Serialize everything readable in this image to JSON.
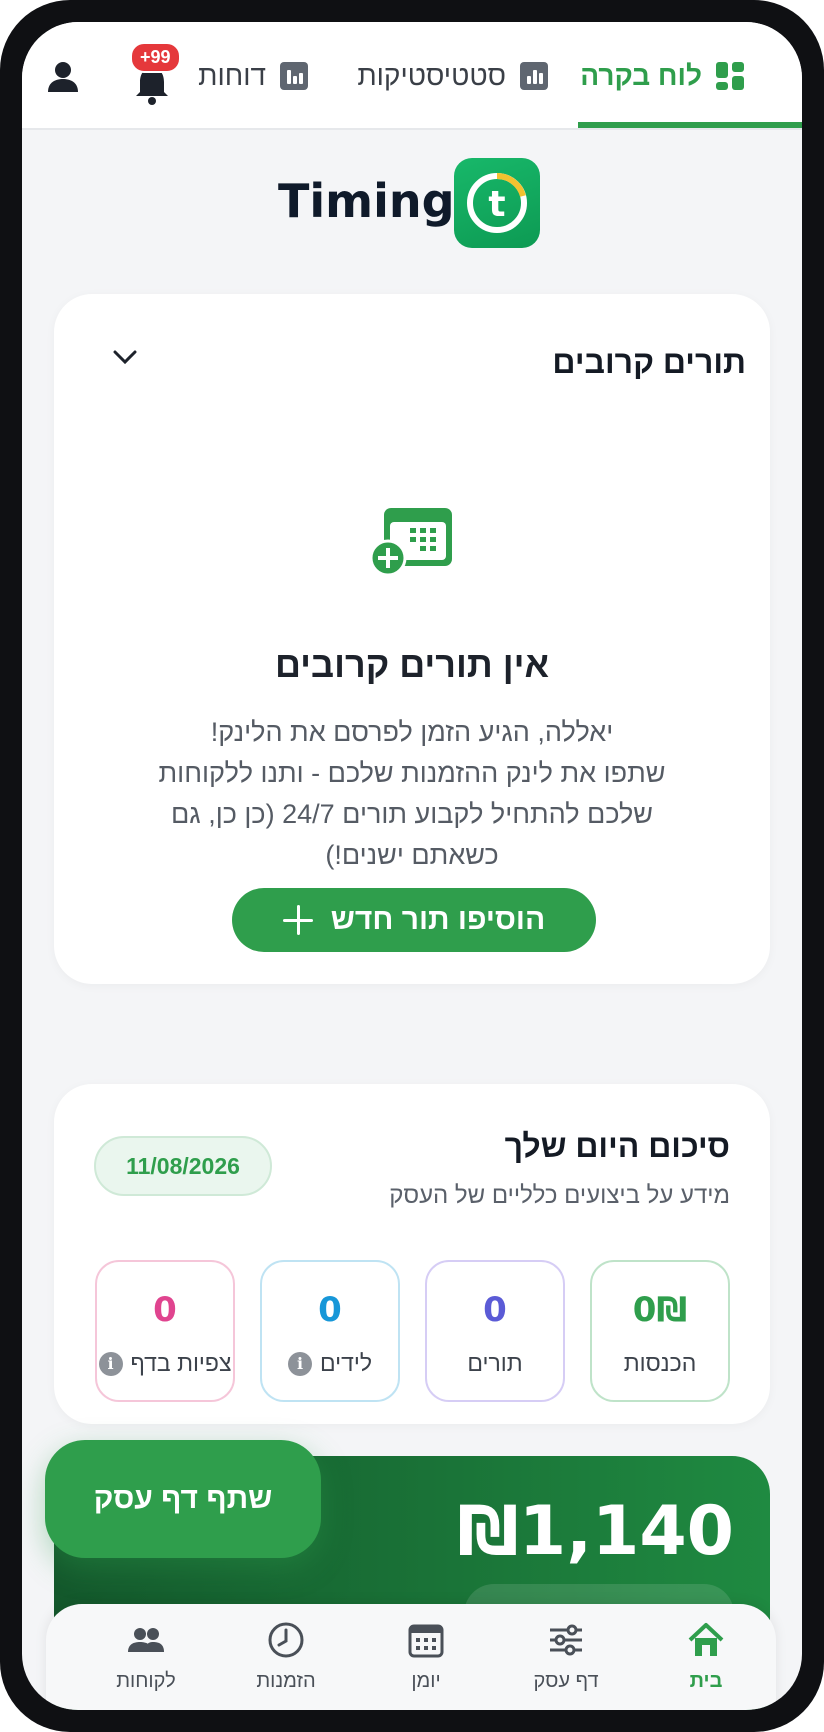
{
  "topnav": {
    "tabs": [
      {
        "label": "לוח בקרה",
        "icon": "dashboard-grid-icon",
        "active": true
      },
      {
        "label": "סטטיסטיקות",
        "icon": "bar-chart-icon",
        "active": false
      },
      {
        "label": "דוחות",
        "icon": "bar-chart-icon",
        "active": false
      }
    ],
    "notifications_badge": "+99",
    "icons": {
      "bell": "bell-icon",
      "user": "user-icon"
    }
  },
  "brand": {
    "name": "Timing",
    "logo_letter": "t"
  },
  "upcoming": {
    "title": "תורים קרובים",
    "empty_title": "אין תורים קרובים",
    "empty_lines": [
      "יאללה, הגיע הזמן לפרסם את הלינק!",
      "שתפו את לינק ההזמנות שלכם - ותנו ללקוחות",
      "שלכם להתחיל לקבוע תורים 24/7 (כן כן, גם",
      "כשאתם ישנים!)"
    ],
    "add_button": "הוסיפו תור חדש"
  },
  "summary": {
    "title": "סיכום היום שלך",
    "subtitle": "מידע על ביצועים כלליים של העסק",
    "date": "11/08/2026",
    "stats": [
      {
        "label": "הכנסות",
        "value": "0₪",
        "color": "#2f9e4c",
        "border": "#bfe3c9"
      },
      {
        "label": "תורים",
        "value": "0",
        "color": "#5b5bd6",
        "border": "#d6cdf5"
      },
      {
        "label": "לידים",
        "value": "0",
        "color": "#1797d8",
        "border": "#bfe3f3",
        "info": true
      },
      {
        "label": "צפיות בדף",
        "value": "0",
        "color": "#e0448f",
        "border": "#f5c6d9",
        "info": true
      }
    ],
    "info_glyph": "i"
  },
  "revenue": {
    "amount": "₪1,140"
  },
  "share_button": "שתף דף עסק",
  "bottomnav": [
    {
      "label": "בית",
      "icon": "home-icon",
      "active": true
    },
    {
      "label": "דף עסק",
      "icon": "sliders-icon",
      "active": false
    },
    {
      "label": "יומן",
      "icon": "calendar-icon",
      "active": false
    },
    {
      "label": "הזמנות",
      "icon": "clock-icon",
      "active": false
    },
    {
      "label": "לקוחות",
      "icon": "users-icon",
      "active": false
    }
  ],
  "colors": {
    "accent": "#2f9e4c",
    "badge": "#e5383b",
    "dark_bg": "#0f1013"
  }
}
